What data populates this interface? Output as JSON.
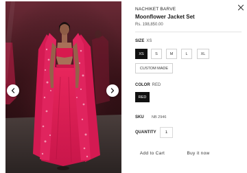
{
  "product": {
    "designer": "NACHIKET BARVE",
    "name": "Moonflower Jacket Set",
    "price": "Rs. 198,850.00"
  },
  "size": {
    "label": "SIZE",
    "selected": "XS",
    "options": [
      "XS",
      "S",
      "M",
      "L",
      "XL",
      "CUSTOM MADE"
    ]
  },
  "color": {
    "label": "COLOR",
    "selected": "RED",
    "options": [
      "RED"
    ]
  },
  "sku": {
    "label": "SKU",
    "value": "NB 2946"
  },
  "quantity": {
    "label": "QUANTITY",
    "value": "1"
  },
  "actions": {
    "add_to_cart": "Add to Cart",
    "buy_now": "Buy it now"
  },
  "icons": {
    "close": "close-icon",
    "prev": "chevron-left-icon",
    "next": "chevron-right-icon"
  },
  "colors": {
    "selected_fill": "#111111",
    "border": "#cfcfcf",
    "garment": "#e0245e"
  }
}
